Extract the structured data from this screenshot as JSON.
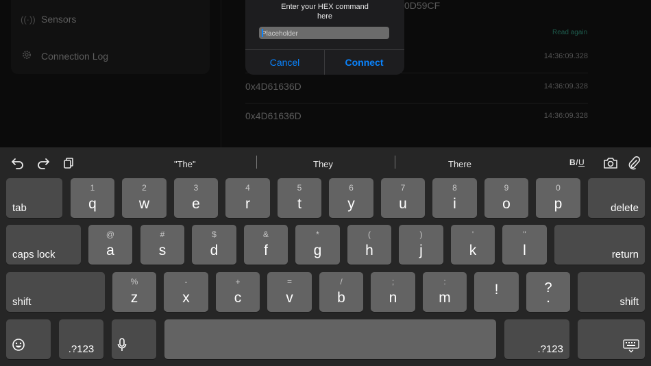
{
  "sidebar": {
    "items": [
      {
        "label": "Sensors",
        "icon": "sensor-icon"
      },
      {
        "label": "Connection Log",
        "icon": "gear-icon"
      }
    ]
  },
  "log": {
    "header_value": "0D59CF",
    "read_again": "Read again",
    "rows": [
      {
        "value": "",
        "time": "14:36:09.328"
      },
      {
        "value": "0x4D61636D",
        "time": "14:36:09.328"
      },
      {
        "value": "0x4D61636D",
        "time": "14:36:09.328"
      }
    ]
  },
  "dialog": {
    "message": "Enter your HEX command here",
    "placeholder": "Placeholder",
    "cancel_label": "Cancel",
    "connect_label": "Connect",
    "accent_color": "#0a84ff"
  },
  "keyboard": {
    "suggestions": [
      "\"The\"",
      "They",
      "There"
    ],
    "format": {
      "bold": "B",
      "italic": "I",
      "underline": "U"
    },
    "row1": [
      {
        "hint": "1",
        "char": "q"
      },
      {
        "hint": "2",
        "char": "w"
      },
      {
        "hint": "3",
        "char": "e"
      },
      {
        "hint": "4",
        "char": "r"
      },
      {
        "hint": "5",
        "char": "t"
      },
      {
        "hint": "6",
        "char": "y"
      },
      {
        "hint": "7",
        "char": "u"
      },
      {
        "hint": "8",
        "char": "i"
      },
      {
        "hint": "9",
        "char": "o"
      },
      {
        "hint": "0",
        "char": "p"
      }
    ],
    "row2": [
      {
        "hint": "@",
        "char": "a"
      },
      {
        "hint": "#",
        "char": "s"
      },
      {
        "hint": "$",
        "char": "d"
      },
      {
        "hint": "&",
        "char": "f"
      },
      {
        "hint": "*",
        "char": "g"
      },
      {
        "hint": "(",
        "char": "h"
      },
      {
        "hint": ")",
        "char": "j"
      },
      {
        "hint": "'",
        "char": "k"
      },
      {
        "hint": "\"",
        "char": "l"
      }
    ],
    "row3": [
      {
        "hint": "%",
        "char": "z"
      },
      {
        "hint": "-",
        "char": "x"
      },
      {
        "hint": "+",
        "char": "c"
      },
      {
        "hint": "=",
        "char": "v"
      },
      {
        "hint": "/",
        "char": "b"
      },
      {
        "hint": ";",
        "char": "n"
      },
      {
        "hint": ":",
        "char": "m"
      },
      {
        "hint": "",
        "char": "!"
      },
      {
        "hint": "?",
        "char": "."
      }
    ],
    "tab": "tab",
    "delete": "delete",
    "caps_lock": "caps lock",
    "return": "return",
    "shift_left": "shift",
    "shift_right": "shift",
    "num_left": ".?123",
    "num_right": ".?123"
  }
}
